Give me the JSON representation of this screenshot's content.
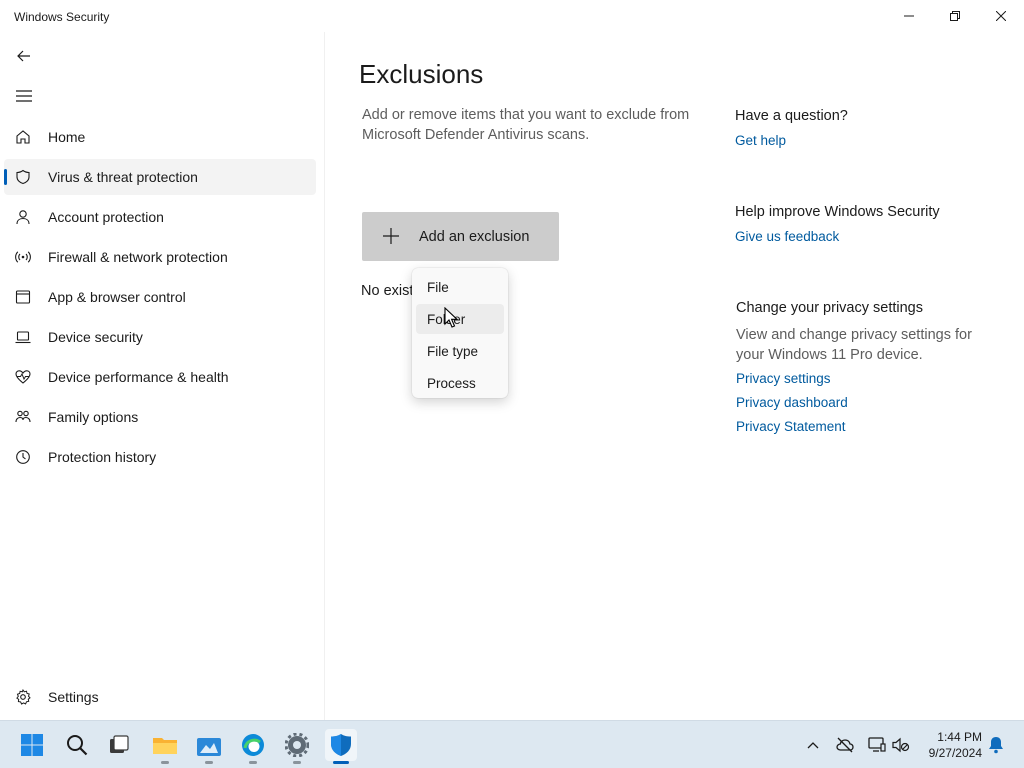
{
  "window": {
    "title": "Windows Security"
  },
  "nav": {
    "items": [
      {
        "label": "Home",
        "icon": "home-icon"
      },
      {
        "label": "Virus & threat protection",
        "icon": "shield-icon",
        "selected": true
      },
      {
        "label": "Account protection",
        "icon": "person-icon"
      },
      {
        "label": "Firewall & network protection",
        "icon": "wifi-signal-icon"
      },
      {
        "label": "App & browser control",
        "icon": "app-window-icon"
      },
      {
        "label": "Device security",
        "icon": "laptop-icon"
      },
      {
        "label": "Device performance & health",
        "icon": "heart-pulse-icon"
      },
      {
        "label": "Family options",
        "icon": "family-icon"
      },
      {
        "label": "Protection history",
        "icon": "history-icon"
      }
    ],
    "settings_label": "Settings"
  },
  "main": {
    "title": "Exclusions",
    "description": "Add or remove items that you want to exclude from Microsoft Defender Antivirus scans.",
    "add_button_label": "Add an exclusion",
    "no_existing_text": "No exist"
  },
  "dropdown": {
    "items": [
      {
        "label": "File"
      },
      {
        "label": "Folder",
        "hovered": true
      },
      {
        "label": "File type"
      },
      {
        "label": "Process"
      }
    ]
  },
  "side": {
    "question_heading": "Have a question?",
    "get_help_link": "Get help",
    "improve_heading": "Help improve Windows Security",
    "feedback_link": "Give us feedback",
    "privacy_heading": "Change your privacy settings",
    "privacy_text": "View and change privacy settings for your Windows 11 Pro device.",
    "privacy_links": [
      "Privacy settings",
      "Privacy dashboard",
      "Privacy Statement"
    ]
  },
  "taskbar": {
    "time": "1:44 PM",
    "date": "9/27/2024",
    "apps": [
      "start-icon",
      "search-icon",
      "task-view-icon",
      "file-explorer-icon",
      "store-icon",
      "edge-icon",
      "settings-icon",
      "windows-security-icon"
    ]
  },
  "colors": {
    "accent": "#005fb8",
    "link": "#005a9e",
    "button_bg": "#cccccc",
    "taskbar_bg": "#dde8f1"
  }
}
